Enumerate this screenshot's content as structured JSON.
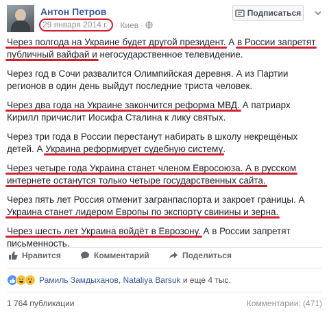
{
  "header": {
    "author": "Антон Петров",
    "date": "29 января 2014 г.",
    "separator": "·",
    "location": "Киев",
    "location_separator": "·",
    "subscribe_label": "Подписаться",
    "icons": [
      "globe-icon",
      "subscribe-icon",
      "chevron-down-icon"
    ]
  },
  "post": {
    "p1": {
      "l1a": "Через полгода на Украине будет другой президент.",
      "l1b": " А ",
      "l1c": "в России запретят",
      "l2a": "публичный вайфай и",
      "l2b": " негосударственное телевидение."
    },
    "p2": {
      "l1": "Через год в Сочи развалится Олимпийская деревня. А из Партии",
      "l2": "регионов в один день выйдут последние триста человек."
    },
    "p3": {
      "l1a": "Через два года на Украине закончится реформа МВД.",
      "l1b": " А патриарх",
      "l2": "Кирилл причислит Иосифа Сталина к лику святых."
    },
    "p4": {
      "l1": "Через три года в России перестанут набирать в школу некрещёных",
      "l2a": "детей. А ",
      "l2b": "Украина реформирует судебную систему",
      "l2c": "."
    },
    "p5": {
      "l1a": "Через четыре года Украина станет членом Евросоюза.",
      "l1b": " ",
      "l1c": "А в русском",
      "l2": "интернете останутся только четыре государственных сайта."
    },
    "p6": {
      "l1": "Через пять лет Россия отменит загранпаспорта и закроет границы. А",
      "l2": "Украина станет лидером Европы по экспорту свинины и зерна."
    },
    "p7": {
      "l1a": "Через шесть лет Украина войдёт в Еврозону.",
      "l1b": " А в России запретят",
      "l2": "письменность."
    }
  },
  "actions": {
    "like_label": "Нравится",
    "comment_label": "Комментарий",
    "share_label": "Поделиться",
    "icons": [
      "thumbs-up-icon",
      "comment-icon",
      "share-icon"
    ]
  },
  "reactions": {
    "names_a": "Рамиль Замдыханов",
    "names_sep": ", ",
    "names_b": "Nataliya Barsuk",
    "names_c": " и еще 4 тыс.",
    "icons": [
      "like-reaction-icon",
      "haha-reaction-icon",
      "wow-reaction-icon"
    ]
  },
  "footer": {
    "shares": "1 764 публикации",
    "comments": "Комментарии: (471)"
  },
  "colors": {
    "accent": "#365899",
    "underline": "#d0202f",
    "muted": "#90949c"
  }
}
